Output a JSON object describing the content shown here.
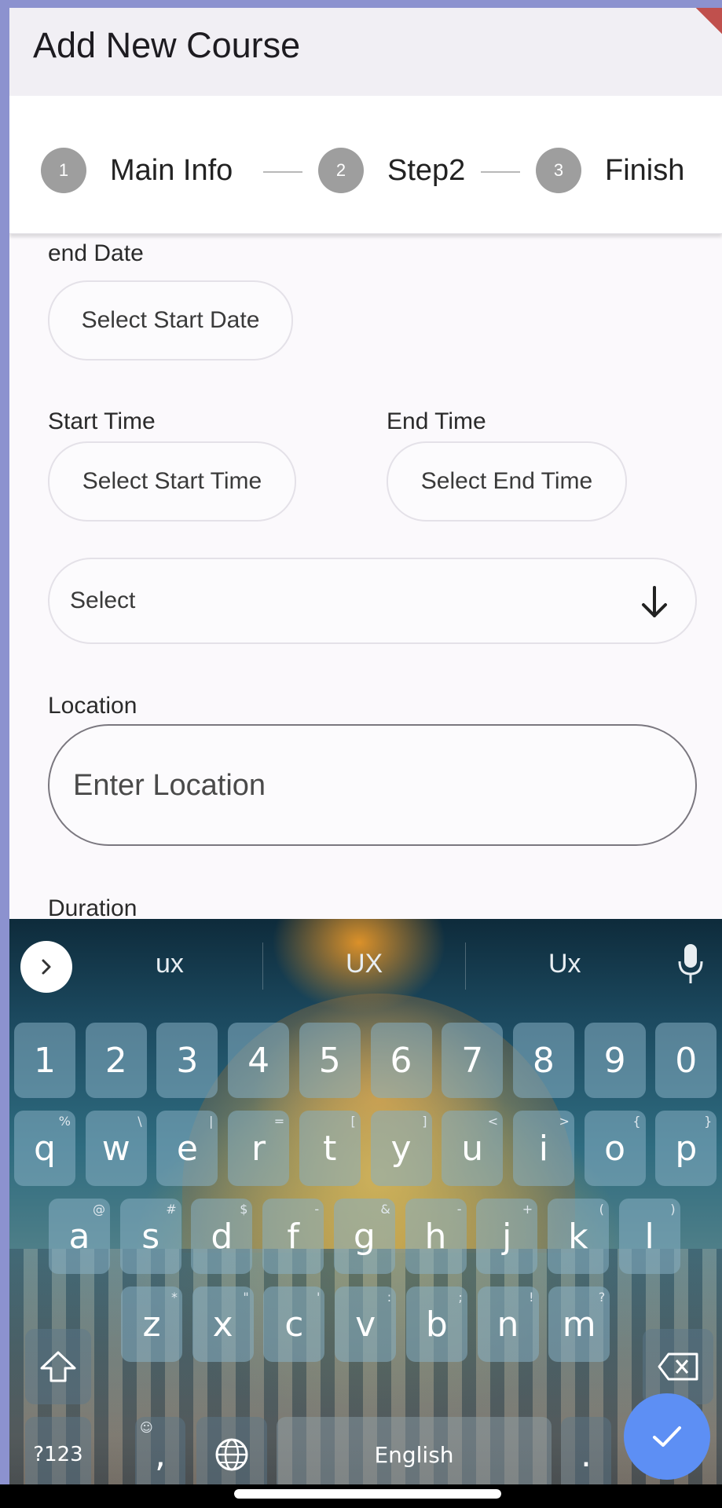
{
  "appbar": {
    "title": "Add New Course"
  },
  "stepper": {
    "steps": [
      {
        "number": "1",
        "label": "Main Info"
      },
      {
        "number": "2",
        "label": "Step2"
      },
      {
        "number": "3",
        "label": "Finish"
      }
    ]
  },
  "form": {
    "end_date_label": "end Date",
    "start_date_button": "Select Start Date",
    "start_time_label": "Start Time",
    "start_time_button": "Select Start Time",
    "end_time_label": "End Time",
    "end_time_button": "Select End Time",
    "dropdown_value": "Select",
    "location_label": "Location",
    "location_placeholder": "Enter Location",
    "duration_label": "Duration"
  },
  "keyboard": {
    "suggestions": [
      "ux",
      "UX",
      "Ux"
    ],
    "number_row": [
      "1",
      "2",
      "3",
      "4",
      "5",
      "6",
      "7",
      "8",
      "9",
      "0"
    ],
    "row1": [
      {
        "k": "q",
        "h": "%"
      },
      {
        "k": "w",
        "h": "\\"
      },
      {
        "k": "e",
        "h": "|"
      },
      {
        "k": "r",
        "h": "="
      },
      {
        "k": "t",
        "h": "["
      },
      {
        "k": "y",
        "h": "]"
      },
      {
        "k": "u",
        "h": "<"
      },
      {
        "k": "i",
        "h": ">"
      },
      {
        "k": "o",
        "h": "{"
      },
      {
        "k": "p",
        "h": "}"
      }
    ],
    "row2": [
      {
        "k": "a",
        "h": "@"
      },
      {
        "k": "s",
        "h": "#"
      },
      {
        "k": "d",
        "h": "$"
      },
      {
        "k": "f",
        "h": "-"
      },
      {
        "k": "g",
        "h": "&"
      },
      {
        "k": "h",
        "h": "-"
      },
      {
        "k": "j",
        "h": "+"
      },
      {
        "k": "k",
        "h": "("
      },
      {
        "k": "l",
        "h": ")"
      }
    ],
    "row3": [
      {
        "k": "z",
        "h": "*"
      },
      {
        "k": "x",
        "h": "\""
      },
      {
        "k": "c",
        "h": "'"
      },
      {
        "k": "v",
        "h": ":"
      },
      {
        "k": "b",
        "h": ";"
      },
      {
        "k": "n",
        "h": "!"
      },
      {
        "k": "m",
        "h": "?"
      }
    ],
    "symbols_key": "?123",
    "comma_key": ",",
    "period_key": ".",
    "space_label": "English"
  },
  "colors": {
    "step_inactive": "#9e9e9e",
    "enter_key": "#5d8ff4",
    "page_background": "#fbf9fc"
  }
}
